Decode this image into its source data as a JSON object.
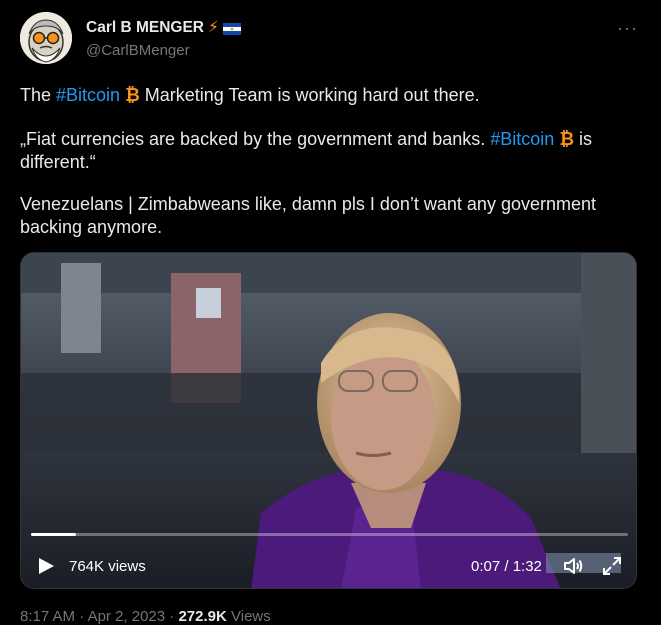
{
  "author": {
    "name": "Carl B MENGER",
    "handle": "@CarlBMenger",
    "badge_lightning": "⚡",
    "more_label": "···"
  },
  "tweet": {
    "line1_pre": "The ",
    "line1_hashtag": "#Bitcoin",
    "btc_symbol": "₿",
    "line1_post": " Marketing Team is working hard out there.",
    "quote_pre": "„Fiat currencies are backed by the government and banks. ",
    "quote_hashtag": "#Bitcoin",
    "quote_post_a": " is",
    "quote_post_b": "different.“",
    "line3": "Venezuelans | Zimbabweans like, damn pls I don’t want any government backing anymore."
  },
  "video": {
    "views": "764K views",
    "time": "0:07 / 1:32",
    "progress": 0.076,
    "icons": [
      "play-icon",
      "volume-icon",
      "fullscreen-icon"
    ]
  },
  "footer": {
    "time": "8:17 AM",
    "sep1": " · ",
    "date": "Apr 2, 2023",
    "sep2": " · ",
    "views_count": "272.9K",
    "views_label": " Views"
  },
  "colors": {
    "background": "#000000",
    "text": "#e7e9ea",
    "hashtag": "#1d9bf0",
    "secondary": "#71767b",
    "bitcoin": "#f7931a"
  }
}
